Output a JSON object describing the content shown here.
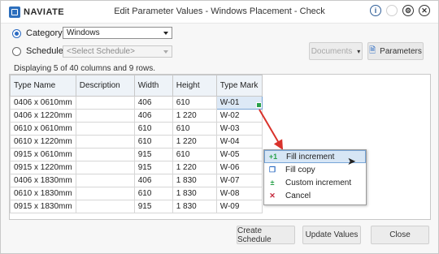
{
  "app": {
    "logo_text": "NAVIATE",
    "title": "Edit Parameter Values - Windows Placement - Check"
  },
  "controls": {
    "category_label": "Category:",
    "category_value": "Windows",
    "schedule_label": "Schedule:",
    "schedule_value": "<Select Schedule>",
    "documents_label": "Documents",
    "parameters_label": "Parameters",
    "info_text": "Displaying 5 of 40 columns and 9 rows."
  },
  "table": {
    "columns": [
      "Type Name",
      "Description",
      "Width",
      "Height",
      "Type Mark"
    ],
    "rows": [
      [
        "0406 x 0610mm",
        "",
        "406",
        "610",
        "W-01"
      ],
      [
        "0406 x 1220mm",
        "",
        "406",
        "1 220",
        "W-02"
      ],
      [
        "0610 x 0610mm",
        "",
        "610",
        "610",
        "W-03"
      ],
      [
        "0610 x 1220mm",
        "",
        "610",
        "1 220",
        "W-04"
      ],
      [
        "0915 x 0610mm",
        "",
        "915",
        "610",
        "W-05"
      ],
      [
        "0915 x 1220mm",
        "",
        "915",
        "1 220",
        "W-06"
      ],
      [
        "0406 x 1830mm",
        "",
        "406",
        "1 830",
        "W-07"
      ],
      [
        "0610 x 1830mm",
        "",
        "610",
        "1 830",
        "W-08"
      ],
      [
        "0915 x 1830mm",
        "",
        "915",
        "1 830",
        "W-09"
      ]
    ]
  },
  "context_menu": {
    "items": [
      {
        "label": "Fill increment",
        "icon": "fill-increment-icon",
        "glyph": "+1"
      },
      {
        "label": "Fill copy",
        "icon": "copy-icon",
        "glyph": "❐"
      },
      {
        "label": "Custom increment",
        "icon": "custom-increment-icon",
        "glyph": "±"
      },
      {
        "label": "Cancel",
        "icon": "cancel-icon",
        "glyph": "✕"
      }
    ]
  },
  "footer": {
    "create_schedule": "Create Schedule",
    "update_values": "Update Values",
    "close": "Close"
  },
  "colors": {
    "accent": "#2c6bc2",
    "arrow": "#d9322b",
    "handle": "#29a14a"
  }
}
